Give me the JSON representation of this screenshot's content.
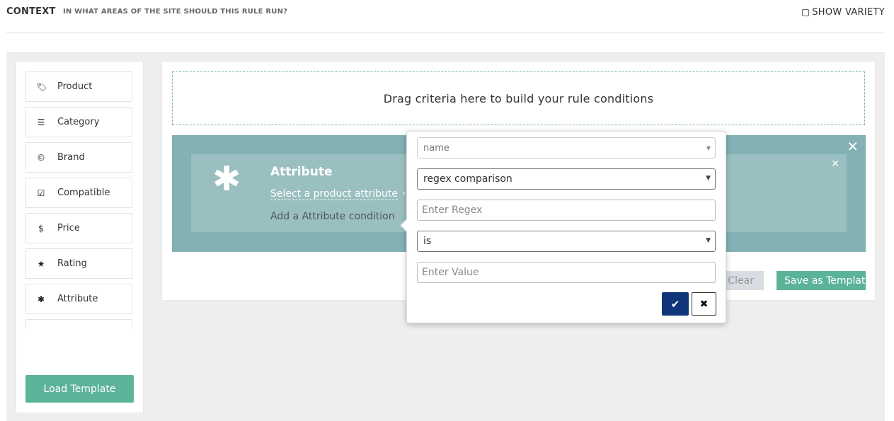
{
  "header": {
    "title": "CONTEXT",
    "subtitle": "IN WHAT AREAS OF THE SITE SHOULD THIS RULE RUN?",
    "variety_label": "SHOW VARIETY"
  },
  "sidebar": {
    "items": [
      {
        "label": "Product",
        "icon": "🏷"
      },
      {
        "label": "Category",
        "icon": "☰"
      },
      {
        "label": "Brand",
        "icon": "©"
      },
      {
        "label": "Compatible",
        "icon": "☑"
      },
      {
        "label": "Price",
        "icon": "$"
      },
      {
        "label": "Rating",
        "icon": "★"
      },
      {
        "label": "Attribute",
        "icon": "✱"
      }
    ],
    "load_template": "Load Template"
  },
  "canvas": {
    "drop_text": "Drag criteria here to build your rule conditions",
    "group_close": "✕",
    "condition": {
      "icon": "✱",
      "title": "Attribute",
      "select_link": "Select a product attribute",
      "arrow": "›",
      "add_text": "Add a Attribute condition",
      "close": "✕"
    },
    "clear_label": "Clear",
    "save_template": "Save as Template"
  },
  "popup": {
    "attribute_value": "name",
    "comparison_value": "regex comparison",
    "regex_placeholder": "Enter Regex",
    "operator_value": "is",
    "value_placeholder": "Enter Value",
    "ok_icon": "✔",
    "cancel_icon": "✖"
  },
  "colors": {
    "accent_green": "#5bb39a",
    "group_teal": "#83b1b4",
    "condition_teal": "#9abfc0",
    "confirm_navy": "#10357a"
  }
}
